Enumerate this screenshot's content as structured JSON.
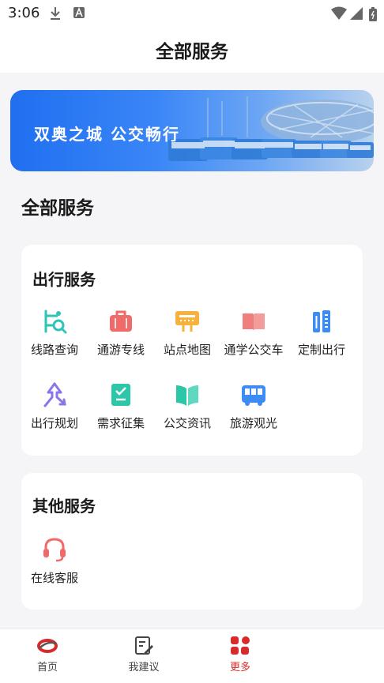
{
  "status_bar": {
    "time": "3:06"
  },
  "header": {
    "title": "全部服务"
  },
  "banner": {
    "text": "双奥之城  公交畅行"
  },
  "section": {
    "title": "全部服务"
  },
  "travel": {
    "title": "出行服务",
    "items": [
      {
        "label": "线路查询",
        "icon": "route-search-icon",
        "color": "#2ec4b6"
      },
      {
        "label": "通游专线",
        "icon": "briefcase-icon",
        "color": "#f06a6a"
      },
      {
        "label": "站点地图",
        "icon": "station-sign-icon",
        "color": "#f6b23c"
      },
      {
        "label": "通学公交车",
        "icon": "book-icon",
        "color": "#f07e7e"
      },
      {
        "label": "定制出行",
        "icon": "custom-ruler-icon",
        "color": "#3d8cf5"
      },
      {
        "label": "出行规划",
        "icon": "plan-arrow-icon",
        "color": "#8d74e8"
      },
      {
        "label": "需求征集",
        "icon": "clipboard-check-icon",
        "color": "#2cc7a8"
      },
      {
        "label": "公交资讯",
        "icon": "open-book-icon",
        "color": "#2cc7a8"
      },
      {
        "label": "旅游观光",
        "icon": "bus-icon",
        "color": "#3d8cf5"
      }
    ]
  },
  "other": {
    "title": "其他服务",
    "items": [
      {
        "label": "在线客服",
        "icon": "headset-icon",
        "color": "#f06a6a"
      }
    ]
  },
  "tabs": [
    {
      "label": "首页",
      "icon": "home-logo-icon"
    },
    {
      "label": "我建议",
      "icon": "edit-note-icon"
    },
    {
      "label": "更多",
      "icon": "more-grid-icon",
      "active": true
    }
  ],
  "colors": {
    "accent": "#d82a2a",
    "banner_blue": "#1f6ff0"
  }
}
